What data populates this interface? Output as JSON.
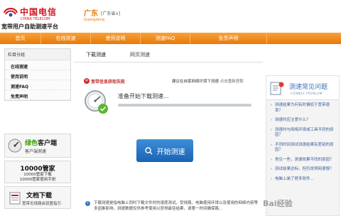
{
  "header": {
    "logo_cn": "中国电信",
    "logo_en": "CHINA TELECOM",
    "subtitle": "宽带用户自助测速平台",
    "region_cn": "广东",
    "region_en": "Guangdong",
    "region_select": "[广东省∨]"
  },
  "nav": {
    "items": [
      "首页",
      "在线测速",
      "使用说明",
      "测速FAQ",
      "免责声明"
    ]
  },
  "sidebar": {
    "title": "栏目分组",
    "items": [
      "在线测速",
      "使用说明",
      "测速FAQ",
      "免责声明"
    ],
    "promo_client": {
      "title_green": "绿色",
      "title_rest": "客户端",
      "sub": "客户端测速"
    },
    "promo_10000": {
      "title": "10000管家",
      "line1": "10000管家下载",
      "line2": "10000管家使用手册"
    },
    "promo_docs": {
      "title": "文档下载",
      "sub": "宽带无线路由设置指引"
    }
  },
  "main": {
    "tabs": [
      "下载测速",
      "网页测速"
    ],
    "fail_text": "宽带信息获取失败",
    "advice_text": "建议在自家网络环境下测速",
    "advice_link": "点击重新获取",
    "prep_text": "准备开始下载测速...",
    "progress_fraction": 1.0,
    "start_button": "开始测速",
    "note_text": "下载测速是指电脑上同时下载文件时的速度测试，受线路、电脑使用环境以及使用的网络内容等多因素影响，测速数据仅供参考使用以获得最佳结果，请第一时间确保路..."
  },
  "faq": {
    "title": "测速常见问题",
    "subtitle": "CONNEX PROBLEM",
    "items": [
      "测速结果为何有时偏低于宽带速率？",
      "测速时应注意什么？",
      "测速时与网络环境或工具不同的原因？",
      "不同时间测试测速结果有差别的原因？",
      "常见一些，测速效果不同的原因？",
      "测试结果达标，但仍觉得网速慢？",
      "电脑上装了很多软件..."
    ]
  },
  "watermark": {
    "text": "Bai经验"
  },
  "colors": {
    "brand_red": "#d2141d",
    "nav_orange": "#ef8410",
    "button_blue": "#2673c4",
    "faq_blue": "#3771b6"
  }
}
